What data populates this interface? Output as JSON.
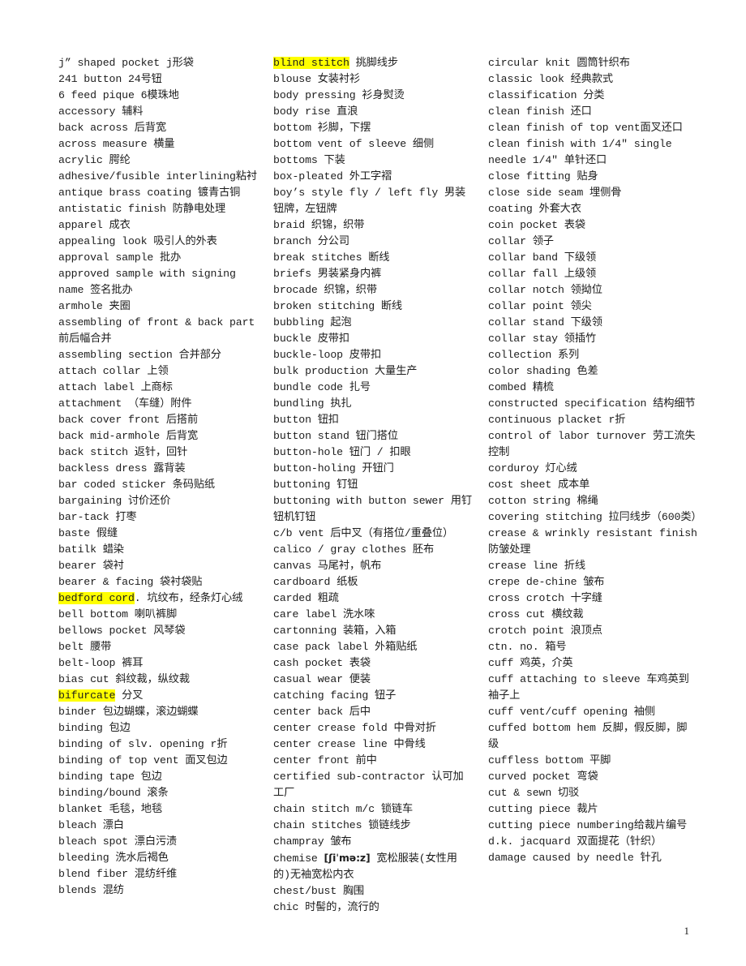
{
  "document": {
    "type": "glossary",
    "page_number": "1",
    "highlight_color": "#ffff00",
    "columns": [
      {
        "id": "column-1",
        "entries": [
          {
            "text": "j”  shaped pocket  j形袋"
          },
          {
            "text": "241 button 24号钮"
          },
          {
            "text": "6 feed pique 6模珠地"
          },
          {
            "text": "accessory 辅料"
          },
          {
            "text": "back across 后背宽"
          },
          {
            "text": "across measure 横量"
          },
          {
            "text": "acrylic 腭纶"
          },
          {
            "text": "adhesive/fusible interlining粘衬"
          },
          {
            "text": "antique brass coating 镀青古铜"
          },
          {
            "text": "antistatic finish 防静电处理"
          },
          {
            "text": "apparel 成衣"
          },
          {
            "text": "appealing look 吸引人的外表"
          },
          {
            "text": "approval sample 批办"
          },
          {
            "text": "approved sample with signing name 签名批办"
          },
          {
            "text": "armhole 夹圈"
          },
          {
            "text": "assembling of front & back part 前后幅合并"
          },
          {
            "text": "assembling section 合并部分"
          },
          {
            "text": "attach collar 上领"
          },
          {
            "text": "attach label 上商标"
          },
          {
            "text": "attachment （车缝）附件"
          },
          {
            "text": "back cover front 后搭前"
          },
          {
            "text": "back mid-armhole 后背宽"
          },
          {
            "text": "back stitch 返针，回针"
          },
          {
            "text": "backless dress 露背装"
          },
          {
            "text": "bar coded sticker 条码贴纸"
          },
          {
            "text": "bargaining 讨价还价"
          },
          {
            "text": "bar-tack 打枣"
          },
          {
            "text": "baste 假缝"
          },
          {
            "text": "batilk 蜡染"
          },
          {
            "text": "bearer 袋衬"
          },
          {
            "text": "bearer & facing 袋衬袋贴"
          },
          {
            "text": "bedford cord",
            "highlight": "bedford cord",
            "rest": ". 坑纹布，经条灯心绒"
          },
          {
            "text": "bell bottom 喇叭裤脚"
          },
          {
            "text": "bellows pocket 风琴袋"
          },
          {
            "text": "belt 腰带"
          },
          {
            "text": "belt-loop 裤耳"
          },
          {
            "text": "bias cut 斜纹裁，纵纹裁"
          },
          {
            "text": "bifurcate",
            "highlight": "bifurcate",
            "rest": " 分叉"
          },
          {
            "text": "binder 包边蝴蝶，滚边蝴蝶"
          },
          {
            "text": "binding 包边"
          },
          {
            "text": "binding of slv. opening r折"
          },
          {
            "text": "binding of top vent 面叉包边"
          },
          {
            "text": "binding tape 包边"
          },
          {
            "text": "binding/bound 滚条"
          },
          {
            "text": "blanket 毛毯，地毯"
          },
          {
            "text": "bleach 漂白"
          },
          {
            "text": "bleach spot 漂白污渍"
          },
          {
            "text": "bleeding 洗水后褐色"
          },
          {
            "text": "blend fiber 混纺纤维"
          },
          {
            "text": "blends 混纺"
          }
        ]
      },
      {
        "id": "column-2",
        "entries": [
          {
            "text": "blind stitch",
            "highlight": "blind stitch",
            "rest": " 挑脚线步"
          },
          {
            "text": "blouse 女装衬衫"
          },
          {
            "text": "body pressing 衫身熨烫"
          },
          {
            "text": "body rise 直浪"
          },
          {
            "text": "bottom 衫脚，下摆"
          },
          {
            "text": "bottom vent of sleeve 细侧"
          },
          {
            "text": "bottoms 下装"
          },
          {
            "text": "box-pleated 外工字褶"
          },
          {
            "text": "boy’s style fly / left fly 男装钮牌，左钮牌"
          },
          {
            "text": "braid 织锦，织带"
          },
          {
            "text": "branch 分公司"
          },
          {
            "text": "break stitches 断线"
          },
          {
            "text": "briefs 男装紧身内裤"
          },
          {
            "text": "brocade 织锦，织带"
          },
          {
            "text": "broken stitching 断线"
          },
          {
            "text": "bubbling 起泡"
          },
          {
            "text": "buckle 皮带扣"
          },
          {
            "text": "buckle-loop 皮带扣"
          },
          {
            "text": "bulk production 大量生产"
          },
          {
            "text": "bundle code 扎号"
          },
          {
            "text": "bundling 执扎"
          },
          {
            "text": "button 钮扣"
          },
          {
            "text": "button stand 钮门搭位"
          },
          {
            "text": "button-hole 钮门 / 扣眼"
          },
          {
            "text": "button-holing 开钮门"
          },
          {
            "text": "buttoning 钉钮"
          },
          {
            "text": "buttoning with button sewer 用钉钮机钉钮"
          },
          {
            "text": "c/b vent 后中叉（有搭位/重叠位）"
          },
          {
            "text": "calico / gray clothes 胚布"
          },
          {
            "text": "canvas 马尾衬，帆布"
          },
          {
            "text": "cardboard 纸板"
          },
          {
            "text": "carded 粗疏"
          },
          {
            "text": "care label 洗水唻"
          },
          {
            "text": "cartonning 装箱，入箱"
          },
          {
            "text": "case pack label 外箱贴纸"
          },
          {
            "text": "cash pocket 表袋"
          },
          {
            "text": "casual wear 便装"
          },
          {
            "text": "catching facing 钮子"
          },
          {
            "text": "center back 后中"
          },
          {
            "text": "center crease fold 中骨对折"
          },
          {
            "text": "center crease line 中骨线"
          },
          {
            "text": "center front 前中"
          },
          {
            "text": "certified sub-contractor 认可加工厂"
          },
          {
            "text": "chain stitch m/c 锁链车"
          },
          {
            "text": "chain stitches 锁链线步"
          },
          {
            "text": "champray 皱布"
          },
          {
            "text": "chemise ",
            "ipa": "[ʃiˈmə:z]",
            "rest": " 宽松服装(女性用的)无袖宽松内衣"
          },
          {
            "text": "chest/bust 胸围"
          },
          {
            "text": "chic 时髻的，流行的"
          }
        ]
      },
      {
        "id": "column-3",
        "entries": [
          {
            "text": "circular knit 圆筒针织布"
          },
          {
            "text": "classic look 经典款式"
          },
          {
            "text": "classification 分类"
          },
          {
            "text": "clean finish 还口"
          },
          {
            "text": "clean finish of top vent面叉还口"
          },
          {
            "text": "clean finish with 1/4″ single needle 1/4″ 单针还口"
          },
          {
            "text": "close fitting 贴身"
          },
          {
            "text": "close side seam 埋侧骨"
          },
          {
            "text": "coating 外套大衣"
          },
          {
            "text": "coin pocket 表袋"
          },
          {
            "text": "collar 领子"
          },
          {
            "text": "collar band 下级领"
          },
          {
            "text": "collar fall 上级领"
          },
          {
            "text": "collar notch 领拗位"
          },
          {
            "text": "collar point 领尖"
          },
          {
            "text": "collar stand 下级领"
          },
          {
            "text": "collar stay 领插竹"
          },
          {
            "text": "collection 系列"
          },
          {
            "text": "color shading 色差"
          },
          {
            "text": "combed 精梳"
          },
          {
            "text": "constructed specification 结构细节"
          },
          {
            "text": "continuous placket r折"
          },
          {
            "text": "control of labor turnover 劳工流失控制"
          },
          {
            "text": "corduroy 灯心绒"
          },
          {
            "text": "cost sheet 成本单"
          },
          {
            "text": "cotton string 棉绳"
          },
          {
            "text": "covering stitching 拉冃线步（600类）"
          },
          {
            "text": "crease & wrinkly resistant finish 防皱处理"
          },
          {
            "text": "crease line 折线"
          },
          {
            "text": "crepe de-chine 皱布"
          },
          {
            "text": "cross crotch 十字缝"
          },
          {
            "text": "cross cut 横纹裁"
          },
          {
            "text": "crotch point 浪顶点"
          },
          {
            "text": "ctn. no. 箱号"
          },
          {
            "text": "cuff 鸡英，介英"
          },
          {
            "text": "cuff attaching to sleeve 车鸡英到袖子上"
          },
          {
            "text": "cuff vent/cuff opening 袖侧"
          },
          {
            "text": "cuffed bottom hem 反脚，假反脚，脚级"
          },
          {
            "text": "cuffless bottom 平脚"
          },
          {
            "text": "curved pocket 弯袋"
          },
          {
            "text": "cut & sewn 切驳"
          },
          {
            "text": "cutting piece 裁片"
          },
          {
            "text": "cutting piece numbering给裁片编号"
          },
          {
            "text": "d.k. jacquard 双面提花（针织）"
          },
          {
            "text": "damage caused by needle 针孔"
          }
        ]
      }
    ]
  }
}
